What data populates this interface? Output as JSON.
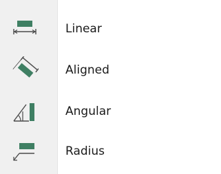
{
  "menu": {
    "items": [
      {
        "label": "Linear",
        "icon": "linear-dimension-icon"
      },
      {
        "label": "Aligned",
        "icon": "aligned-dimension-icon"
      },
      {
        "label": "Angular",
        "icon": "angular-dimension-icon"
      },
      {
        "label": "Radius",
        "icon": "radius-dimension-icon"
      }
    ]
  },
  "colors": {
    "icon_fill": "#3f7f63",
    "icon_line": "#4a4a4a",
    "gutter": "#f0f0f0"
  }
}
